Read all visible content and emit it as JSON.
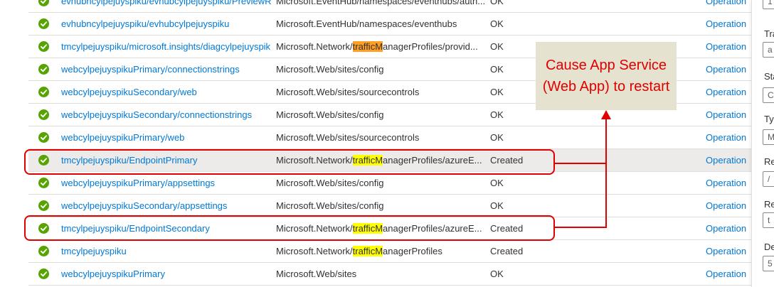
{
  "rows": [
    {
      "name": "evhubncylpejuyspiku/evhubcylpejuyspiku/PreviewR",
      "type_pre": "Microsoft.EventHub/namespaces/eventhubs/auth...",
      "type_hl": "",
      "type_post": "",
      "status": "OK",
      "op": "Operation"
    },
    {
      "name": "evhubncylpejuyspiku/evhubcylpejuyspiku",
      "type_pre": "Microsoft.EventHub/namespaces/eventhubs",
      "type_hl": "",
      "type_post": "",
      "status": "OK",
      "op": "Operation"
    },
    {
      "name": "tmcylpejuyspiku/microsoft.insights/diagcylpejuyspik",
      "type_pre": "Microsoft.Network/",
      "type_hl": "trafficM",
      "type_post": "anagerProfiles/provid...",
      "status": "OK",
      "op": "Operation"
    },
    {
      "name": "webcylpejuyspikuPrimary/connectionstrings",
      "type_pre": "Microsoft.Web/sites/config",
      "type_hl": "",
      "type_post": "",
      "status": "OK",
      "op": "Operation"
    },
    {
      "name": "webcylpejuyspikuSecondary/web",
      "type_pre": "Microsoft.Web/sites/sourcecontrols",
      "type_hl": "",
      "type_post": "",
      "status": "OK",
      "op": "Operation"
    },
    {
      "name": "webcylpejuyspikuSecondary/connectionstrings",
      "type_pre": "Microsoft.Web/sites/config",
      "type_hl": "",
      "type_post": "",
      "status": "OK",
      "op": "Operation"
    },
    {
      "name": "webcylpejuyspikuPrimary/web",
      "type_pre": "Microsoft.Web/sites/sourcecontrols",
      "type_hl": "",
      "type_post": "",
      "status": "OK",
      "op": "Operation"
    },
    {
      "name": "tmcylpejuyspiku/EndpointPrimary",
      "type_pre": "Microsoft.Network/",
      "type_hl": "trafficM",
      "type_post": "anagerProfiles/azureE...",
      "status": "Created",
      "op": "Operation"
    },
    {
      "name": "webcylpejuyspikuPrimary/appsettings",
      "type_pre": "Microsoft.Web/sites/config",
      "type_hl": "",
      "type_post": "",
      "status": "OK",
      "op": "Operation"
    },
    {
      "name": "webcylpejuyspikuSecondary/appsettings",
      "type_pre": "Microsoft.Web/sites/config",
      "type_hl": "",
      "type_post": "",
      "status": "OK",
      "op": "Operation"
    },
    {
      "name": "tmcylpejuyspiku/EndpointSecondary",
      "type_pre": "Microsoft.Network/",
      "type_hl": "trafficM",
      "type_post": "anagerProfiles/azureE...",
      "status": "Created",
      "op": "Operation"
    },
    {
      "name": "tmcylpejuyspiku",
      "type_pre": "Microsoft.Network/",
      "type_hl": "trafficM",
      "type_post": "anagerProfiles",
      "status": "Created",
      "op": "Operation"
    },
    {
      "name": "webcylpejuyspikuPrimary",
      "type_pre": "Microsoft.Web/sites",
      "type_hl": "",
      "type_post": "",
      "status": "OK",
      "op": "Operation"
    }
  ],
  "panel": {
    "labels": [
      "Tra",
      "Sta",
      "Ty",
      "Re",
      "Re",
      "De"
    ],
    "boxes": [
      "1",
      "a",
      "C",
      "M",
      "/",
      "t",
      "5"
    ]
  },
  "callout": {
    "text": "Cause App Service (Web App) to restart"
  },
  "colors": {
    "link": "#0078d4",
    "success": "#57a300",
    "annotation": "#e00000",
    "highlight_yellow": "#ffff00",
    "highlight_orange": "#ff9f26"
  },
  "icons": {
    "status": "success-check-icon"
  }
}
